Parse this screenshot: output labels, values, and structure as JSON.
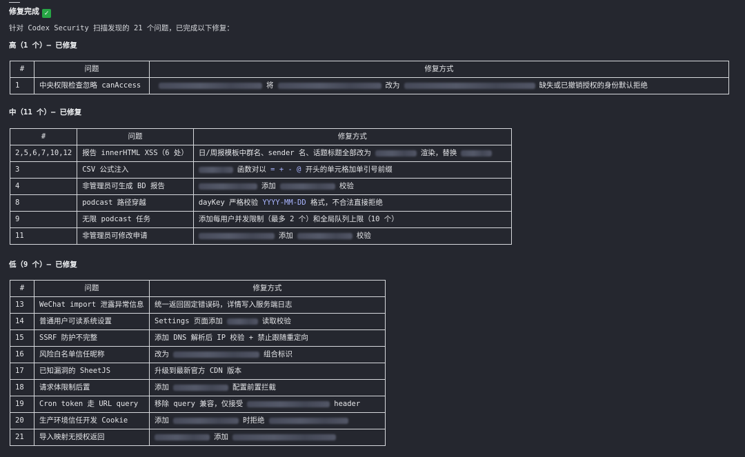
{
  "heading": "修复完成",
  "heading_icon": "check-mark-button-icon",
  "intro": "针对 Codex Security 扫描发现的 21 个问题，已完成以下修复：",
  "sections": {
    "high": {
      "title": "高（1 个）— 已修复",
      "headers": [
        "#",
        "问题",
        "修复方式"
      ],
      "rows": [
        {
          "num": "1",
          "issue": "中央权限检查忽略 canAccess",
          "fix_parts": [
            "将",
            "改为",
            "缺失或已撤销授权的身份默认拒绝"
          ]
        }
      ]
    },
    "medium": {
      "title": "中（11 个）— 已修复",
      "headers": [
        "#",
        "问题",
        "修复方式"
      ],
      "rows": [
        {
          "num": "2,5,6,7,10,12",
          "issue": "报告 innerHTML XSS（6 处）",
          "fix_parts": [
            "日/周报模板中群名、sender 名、话题标题全部改为",
            "渲染，替换"
          ]
        },
        {
          "num": "3",
          "issue": "CSV 公式注入",
          "fix_parts": [
            "函数对以",
            "= + - @",
            "开头的单元格加单引号前缀"
          ]
        },
        {
          "num": "4",
          "issue": "非管理员可生成 BD 报告",
          "fix_parts": [
            "添加",
            "校验"
          ]
        },
        {
          "num": "8",
          "issue": "podcast 路径穿越",
          "fix_parts": [
            "dayKey 严格校验",
            "YYYY-MM-DD",
            "格式，不合法直接拒绝"
          ]
        },
        {
          "num": "9",
          "issue": "无限 podcast 任务",
          "fix_parts": [
            "添加每用户并发限制（最多 2 个）和全局队列上限（10 个）"
          ]
        },
        {
          "num": "11",
          "issue": "非管理员可修改申请",
          "fix_parts": [
            "添加",
            "校验"
          ]
        }
      ]
    },
    "low": {
      "title": "低（9 个）— 已修复",
      "headers": [
        "#",
        "问题",
        "修复方式"
      ],
      "rows": [
        {
          "num": "13",
          "issue": "WeChat import 泄露异常信息",
          "fix_parts": [
            "统一返回固定错误码，详情写入服务端日志"
          ]
        },
        {
          "num": "14",
          "issue": "普通用户可读系统设置",
          "fix_parts": [
            "Settings 页面添加",
            "读取校验"
          ]
        },
        {
          "num": "15",
          "issue": "SSRF 防护不完整",
          "fix_parts": [
            "添加 DNS 解析后 IP 校验 + 禁止跟随重定向"
          ]
        },
        {
          "num": "16",
          "issue": "风险白名单信任昵称",
          "fix_parts": [
            "改为",
            "组合标识"
          ]
        },
        {
          "num": "17",
          "issue": "已知漏洞的 SheetJS",
          "fix_parts": [
            "升级到最新官方 CDN 版本"
          ]
        },
        {
          "num": "18",
          "issue": "请求体限制后置",
          "fix_parts": [
            "添加",
            "配置前置拦截"
          ]
        },
        {
          "num": "19",
          "issue": "Cron token 走 URL query",
          "fix_parts": [
            "移除 query 兼容，仅接受",
            "header"
          ]
        },
        {
          "num": "20",
          "issue": "生产环境信任开发 Cookie",
          "fix_parts": [
            "添加",
            "时拒绝"
          ]
        },
        {
          "num": "21",
          "issue": "导入映射无授权返回",
          "fix_parts": [
            "添加"
          ]
        }
      ]
    }
  }
}
